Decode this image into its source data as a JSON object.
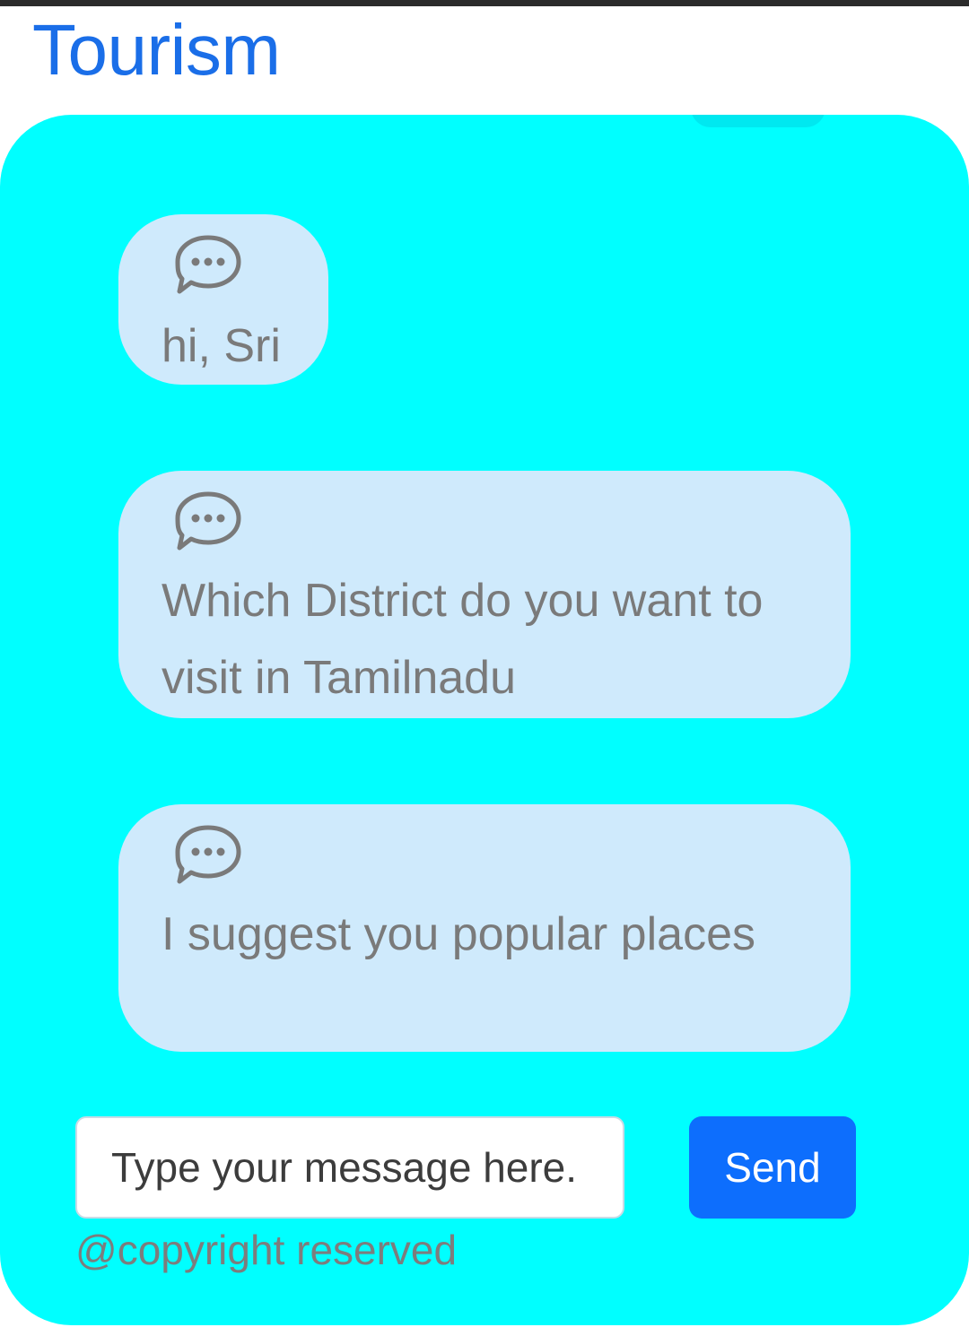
{
  "header": {
    "title": "Tourism",
    "title_color": "#1a6ee8"
  },
  "chat": {
    "background_color": "#00ffff",
    "bubble_color": "#cfeafc",
    "messages": [
      {
        "icon": "chat-bubble-dots-icon",
        "text": "hi, Sri"
      },
      {
        "icon": "chat-bubble-dots-icon",
        "text": "Which District do you want to visit in Tamilnadu"
      },
      {
        "icon": "chat-bubble-dots-icon",
        "text": "I suggest you popular places"
      }
    ]
  },
  "composer": {
    "input_value": "",
    "input_placeholder": "Type your message here.",
    "send_label": "Send",
    "send_color": "#0d6efd"
  },
  "footer": {
    "copyright": "@copyright reserved"
  }
}
